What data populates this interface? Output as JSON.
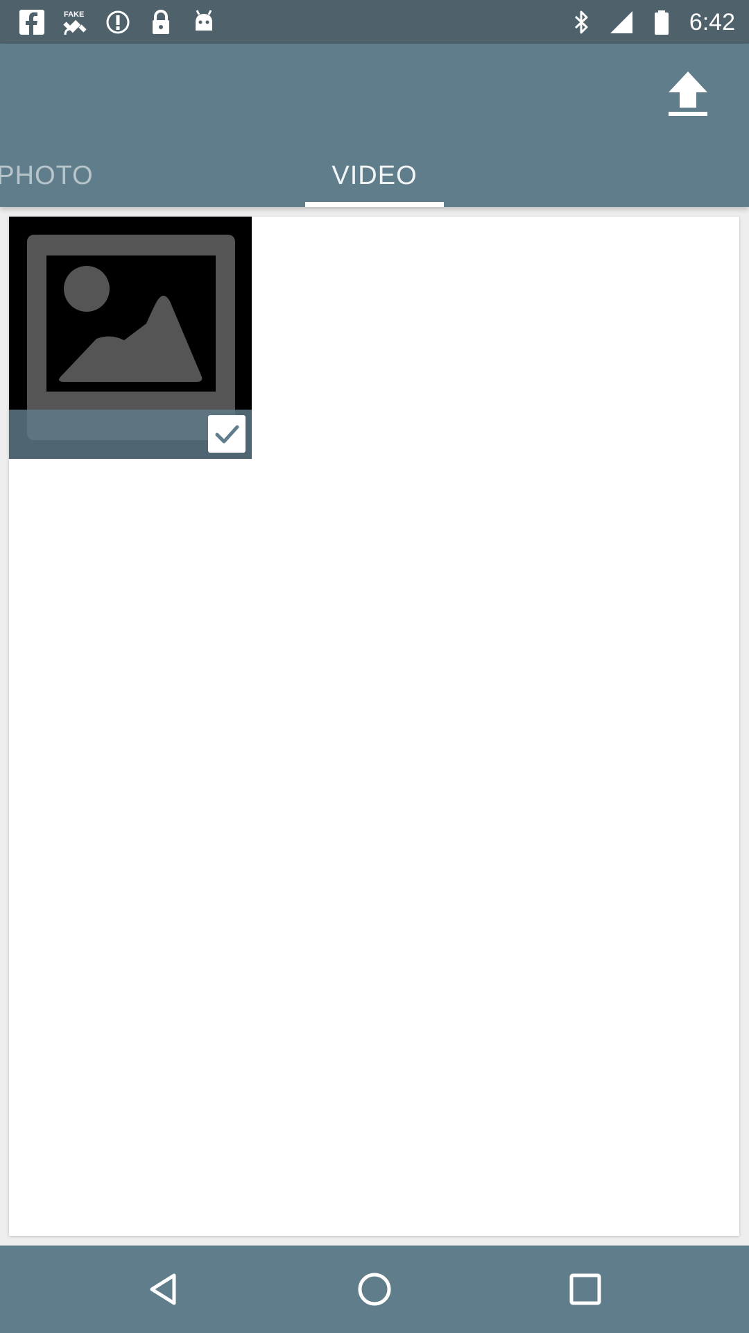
{
  "status_bar": {
    "time": "6:42",
    "left_icons": [
      "facebook-icon",
      "fake-gps-icon",
      "info-circle-icon",
      "lock-icon",
      "android-icon"
    ],
    "right_icons": [
      "bluetooth-icon",
      "signal-icon",
      "battery-icon"
    ]
  },
  "app_bar": {
    "action_icon": "upload-icon"
  },
  "tabs": [
    {
      "label": "PHOTO",
      "selected": false
    },
    {
      "label": "VIDEO",
      "selected": true
    }
  ],
  "media_grid": {
    "items": [
      {
        "icon": "image-placeholder-icon",
        "checked": true
      }
    ]
  },
  "nav_bar": {
    "icons": [
      "back-icon",
      "home-icon",
      "recents-icon"
    ]
  },
  "colors": {
    "primary": "#607d8b",
    "status_bar": "#4f616b",
    "placeholder": "#555555"
  }
}
